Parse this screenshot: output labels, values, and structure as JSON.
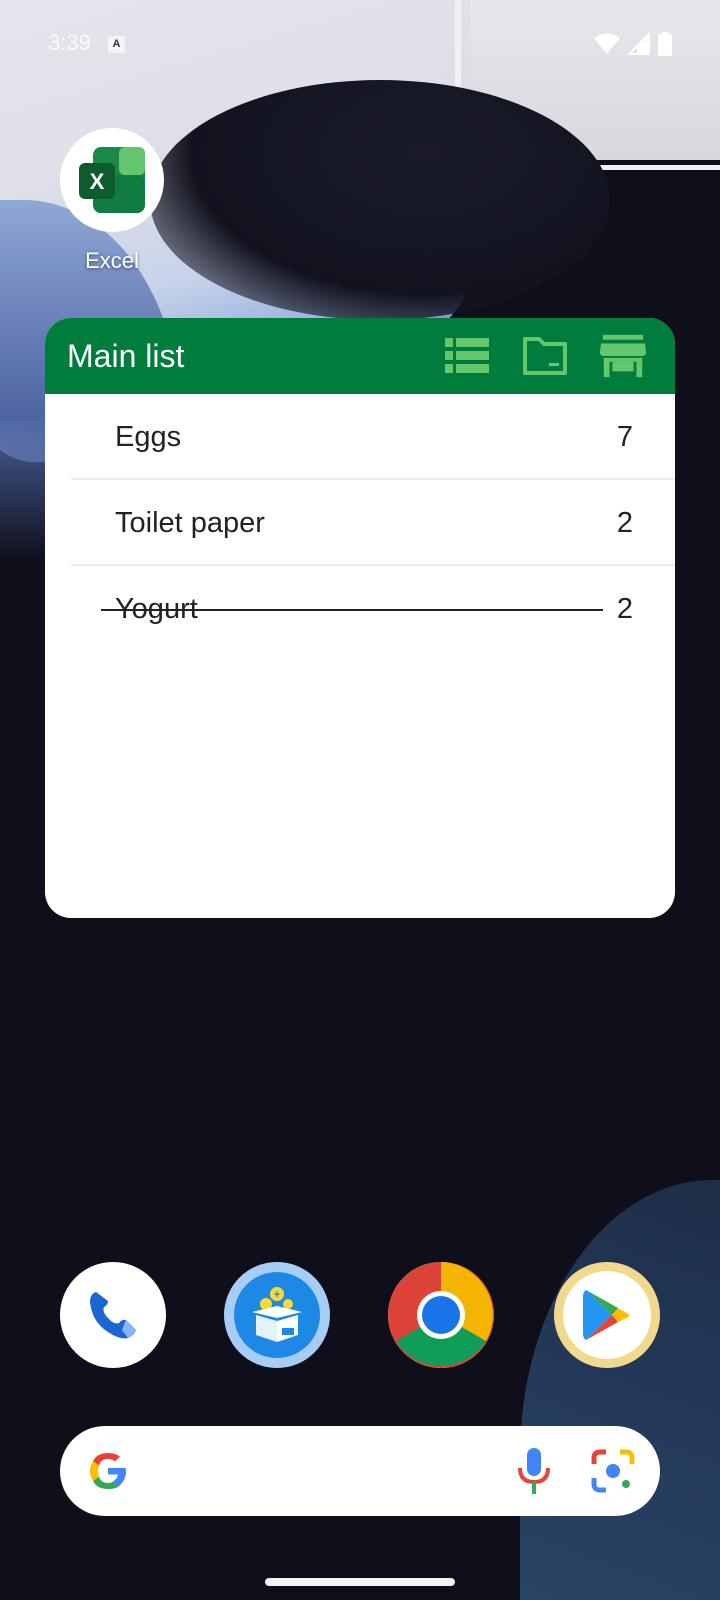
{
  "status_bar": {
    "time": "3:39",
    "icons": [
      "keyboard-a-icon",
      "wifi-icon",
      "cell-signal-icon",
      "battery-icon"
    ]
  },
  "home_apps": [
    {
      "label": "Excel",
      "icon": "excel-icon"
    }
  ],
  "widget": {
    "title": "Main list",
    "header_color": "#007d3c",
    "tools": [
      "list-view-icon",
      "folder-icon",
      "store-icon"
    ],
    "items": [
      {
        "name": "Eggs",
        "qty": "7",
        "checked": false
      },
      {
        "name": "Toilet paper",
        "qty": "2",
        "checked": false
      },
      {
        "name": "Yogurt",
        "qty": "2",
        "checked": true
      }
    ]
  },
  "dock": {
    "apps": [
      "phone-icon",
      "shopping-list-app-icon",
      "chrome-icon",
      "play-store-icon"
    ]
  },
  "search_bar": {
    "icons": [
      "google-g-icon",
      "microphone-icon",
      "google-lens-icon"
    ]
  }
}
